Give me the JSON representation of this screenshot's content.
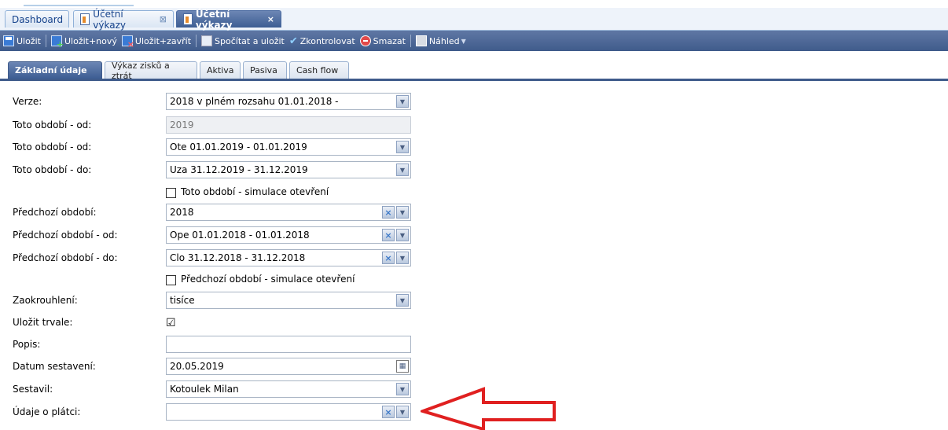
{
  "doc_tabs": [
    {
      "label": "Dashboard"
    },
    {
      "label": "Účetní výkazy"
    },
    {
      "label": "Účetní výkazy"
    }
  ],
  "toolbar": {
    "save": "Uložit",
    "save_new": "Uložit+nový",
    "save_close": "Uložit+zavřít",
    "calc_save": "Spočítat a uložit",
    "check": "Zkontrolovat",
    "delete": "Smazat",
    "preview": "Náhled"
  },
  "section_tabs": [
    {
      "label": "Základní údaje"
    },
    {
      "label": "Výkaz zisků a ztrát"
    },
    {
      "label": "Aktiva"
    },
    {
      "label": "Pasiva"
    },
    {
      "label": "Cash flow"
    }
  ],
  "form": {
    "verze": {
      "label": "Verze:",
      "value": "2018 v plném rozsahu 01.01.2018 -"
    },
    "toto_od_rok": {
      "label": "Toto období - od:",
      "value": "2019"
    },
    "toto_od": {
      "label": "Toto období - od:",
      "value": "Ote 01.01.2019 - 01.01.2019"
    },
    "toto_do": {
      "label": "Toto období - do:",
      "value": "Uza 31.12.2019 - 31.12.2019"
    },
    "toto_sim": {
      "label": "Toto období - simulace otevření",
      "checked": false
    },
    "pred": {
      "label": "Předchozí období:",
      "value": "2018"
    },
    "pred_od": {
      "label": "Předchozí období - od:",
      "value": "Ope 01.01.2018 - 01.01.2018"
    },
    "pred_do": {
      "label": "Předchozí období - do:",
      "value": "Clo 31.12.2018 - 31.12.2018"
    },
    "pred_sim": {
      "label": "Předchozí období - simulace otevření",
      "checked": false
    },
    "zaokr": {
      "label": "Zaokrouhlení:",
      "value": "tisíce"
    },
    "ulozit_trvale": {
      "label": "Uložit trvale:",
      "checked": true,
      "mark": "☑"
    },
    "popis": {
      "label": "Popis:",
      "value": ""
    },
    "datum": {
      "label": "Datum sestavení:",
      "value": "20.05.2019"
    },
    "sestavil": {
      "label": "Sestavil:",
      "value": "Kotoulek Milan"
    },
    "platce": {
      "label": "Údaje o plátci:",
      "value": ""
    }
  },
  "colors": {
    "toolbar": "#3f5b8b",
    "annotation_arrow": "#e02020"
  }
}
